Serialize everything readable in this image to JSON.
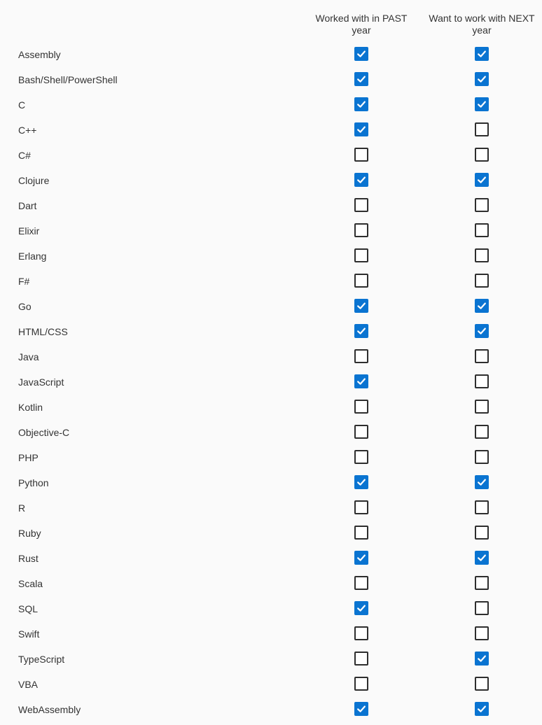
{
  "columns": {
    "past_label": "Worked with in PAST year",
    "next_label": "Want to work with NEXT year"
  },
  "languages": [
    {
      "name": "Assembly",
      "past": true,
      "next": true
    },
    {
      "name": "Bash/Shell/PowerShell",
      "past": true,
      "next": true
    },
    {
      "name": "C",
      "past": true,
      "next": true
    },
    {
      "name": "C++",
      "past": true,
      "next": false
    },
    {
      "name": "C#",
      "past": false,
      "next": false
    },
    {
      "name": "Clojure",
      "past": true,
      "next": true
    },
    {
      "name": "Dart",
      "past": false,
      "next": false
    },
    {
      "name": "Elixir",
      "past": false,
      "next": false
    },
    {
      "name": "Erlang",
      "past": false,
      "next": false
    },
    {
      "name": "F#",
      "past": false,
      "next": false
    },
    {
      "name": "Go",
      "past": true,
      "next": true
    },
    {
      "name": "HTML/CSS",
      "past": true,
      "next": true
    },
    {
      "name": "Java",
      "past": false,
      "next": false
    },
    {
      "name": "JavaScript",
      "past": true,
      "next": false
    },
    {
      "name": "Kotlin",
      "past": false,
      "next": false
    },
    {
      "name": "Objective-C",
      "past": false,
      "next": false
    },
    {
      "name": "PHP",
      "past": false,
      "next": false
    },
    {
      "name": "Python",
      "past": true,
      "next": true
    },
    {
      "name": "R",
      "past": false,
      "next": false
    },
    {
      "name": "Ruby",
      "past": false,
      "next": false
    },
    {
      "name": "Rust",
      "past": true,
      "next": true
    },
    {
      "name": "Scala",
      "past": false,
      "next": false
    },
    {
      "name": "SQL",
      "past": true,
      "next": false
    },
    {
      "name": "Swift",
      "past": false,
      "next": false
    },
    {
      "name": "TypeScript",
      "past": false,
      "next": true
    },
    {
      "name": "VBA",
      "past": false,
      "next": false
    },
    {
      "name": "WebAssembly",
      "past": true,
      "next": true
    }
  ],
  "colors": {
    "checked": "#0a74d1",
    "unchecked_border": "#2e2e2e",
    "background": "#fafafa",
    "text": "#333333"
  },
  "icons": {
    "check": "checkmark-icon"
  }
}
